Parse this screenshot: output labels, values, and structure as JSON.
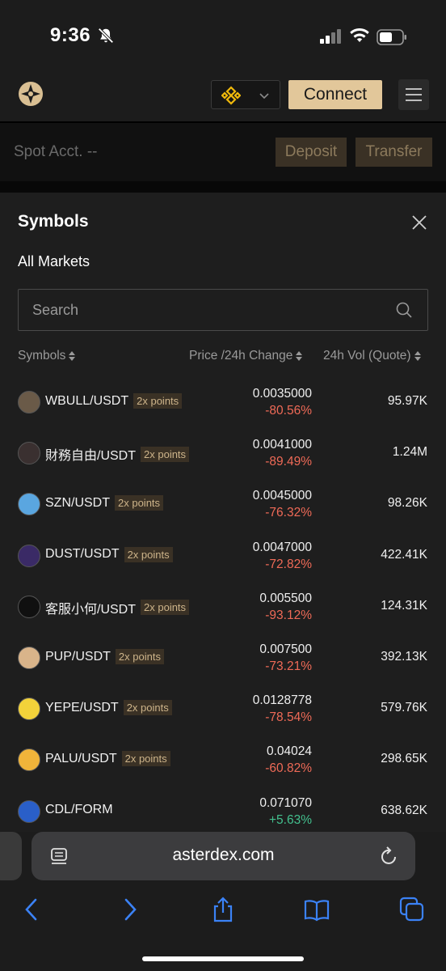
{
  "status": {
    "time": "9:36"
  },
  "header": {
    "connect_label": "Connect"
  },
  "account": {
    "label": "Spot Acct. --",
    "deposit_label": "Deposit",
    "transfer_label": "Transfer"
  },
  "sheet": {
    "title": "Symbols",
    "filter_label": "All Markets",
    "search_placeholder": "Search",
    "columns": {
      "symbol": "Symbols",
      "price": "Price /24h Change",
      "volume": "24h Vol (Quote)"
    },
    "rows": [
      {
        "pair": "WBULL/USDT",
        "badge": "2x points",
        "price": "0.0035000",
        "change": "-80.56%",
        "volume": "95.97K",
        "icon": "wbull-icon",
        "icon_color": "#6a5a48",
        "direction": "down"
      },
      {
        "pair": "財務自由/USDT",
        "badge": "2x points",
        "price": "0.0041000",
        "change": "-89.49%",
        "volume": "1.24M",
        "icon": "avatar-icon",
        "icon_color": "#3a3030",
        "direction": "down"
      },
      {
        "pair": "SZN/USDT",
        "badge": "2x points",
        "price": "0.0045000",
        "change": "-76.32%",
        "volume": "98.26K",
        "icon": "szn-icon",
        "icon_color": "#5aa6e0",
        "direction": "down"
      },
      {
        "pair": "DUST/USDT",
        "badge": "2x points",
        "price": "0.0047000",
        "change": "-72.82%",
        "volume": "422.41K",
        "icon": "dust-icon",
        "icon_color": "#3a2a66",
        "direction": "down"
      },
      {
        "pair": "客服小何/USDT",
        "badge": "2x points",
        "price": "0.005500",
        "change": "-93.12%",
        "volume": "124.31K",
        "icon": "kefu-icon",
        "icon_color": "#101010",
        "direction": "down"
      },
      {
        "pair": "PUP/USDT",
        "badge": "2x points",
        "price": "0.007500",
        "change": "-73.21%",
        "volume": "392.13K",
        "icon": "pup-icon",
        "icon_color": "#d9b48a",
        "direction": "down"
      },
      {
        "pair": "YEPE/USDT",
        "badge": "2x points",
        "price": "0.0128778",
        "change": "-78.54%",
        "volume": "579.76K",
        "icon": "yepe-icon",
        "icon_color": "#f2d23a",
        "direction": "down"
      },
      {
        "pair": "PALU/USDT",
        "badge": "2x points",
        "price": "0.04024",
        "change": "-60.82%",
        "volume": "298.65K",
        "icon": "palu-icon",
        "icon_color": "#f0b43a",
        "direction": "down"
      },
      {
        "pair": "CDL/FORM",
        "badge": "",
        "price": "0.071070",
        "change": "+5.63%",
        "volume": "638.62K",
        "icon": "cdl-icon",
        "icon_color": "#2a5fc8",
        "direction": "up"
      }
    ]
  },
  "browser": {
    "url": "asterdex.com"
  },
  "colors": {
    "accent": "#e2c79a",
    "negative": "#ef6a57",
    "positive": "#43c08e",
    "ios_blue": "#3b82f6"
  }
}
